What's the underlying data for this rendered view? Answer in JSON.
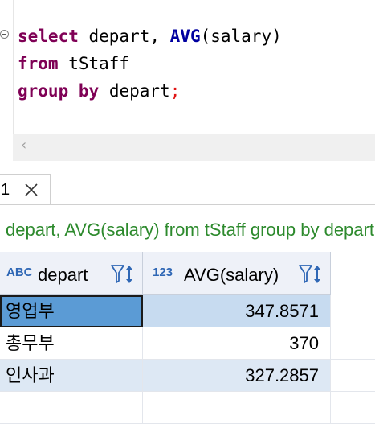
{
  "editor": {
    "lines": [
      {
        "kw1": "select",
        "t1": " depart, ",
        "fn": "AVG",
        "t2": "(salary)"
      },
      {
        "kw1": "from",
        "t1": " tStaff"
      },
      {
        "kw1": "group",
        "t1": " ",
        "kw2": "by",
        "t2": " depart",
        "semi": ";"
      }
    ]
  },
  "scroll": {
    "left_arrow": "‹"
  },
  "tabs": [
    {
      "label": "1"
    }
  ],
  "query_text": "depart, AVG(salary) from tStaff group by depart",
  "grid": {
    "columns": [
      {
        "type_badge": "ABC",
        "label": "depart"
      },
      {
        "type_badge": "123",
        "label": "AVG(salary)"
      }
    ],
    "rows": [
      {
        "depart": "영업부",
        "avg": "347.8571"
      },
      {
        "depart": "총무부",
        "avg": "370"
      },
      {
        "depart": "인사과",
        "avg": "327.2857"
      }
    ]
  },
  "colors": {
    "keyword": "#7f0055",
    "function": "#0000a0",
    "query_text": "#2d8a2d",
    "selected_cell": "#5b9bd5",
    "selected_row": "#c7dbf0",
    "alt_row": "#dde8f4"
  },
  "icons": [
    "fold-collapse-icon",
    "close-icon",
    "filter-icon",
    "sort-icon"
  ]
}
